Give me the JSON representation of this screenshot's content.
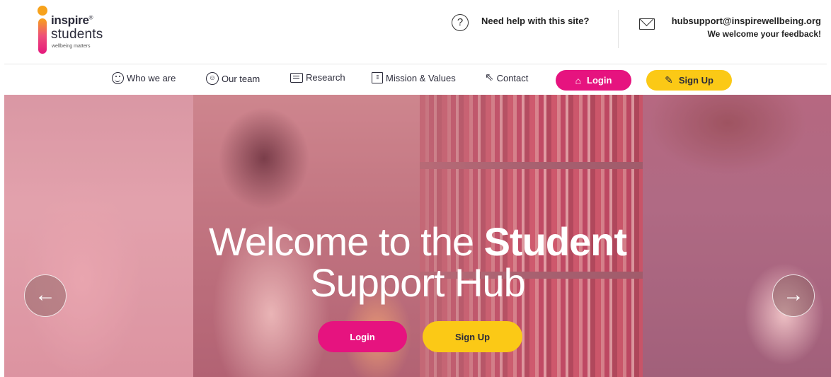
{
  "logo": {
    "brand_top": "inspire",
    "brand_mark": "®",
    "brand_bottom": "students",
    "tagline": "wellbeing matters"
  },
  "header": {
    "help_text": "Need help with this site?",
    "help_icon": "question-circle-icon",
    "email": "hubsupport@inspirewellbeing.org",
    "feedback": "We welcome your feedback!",
    "email_icon": "envelope-icon"
  },
  "nav": {
    "items": [
      {
        "label": "Who we are",
        "icon": "smiley-icon"
      },
      {
        "label": "Our team",
        "icon": "team-icon"
      },
      {
        "label": "Research",
        "icon": "document-icon"
      },
      {
        "label": "Mission & Values",
        "icon": "grid-icon"
      },
      {
        "label": "Contact",
        "icon": "cursor-click-icon"
      }
    ],
    "login_label": "Login",
    "signup_label": "Sign Up"
  },
  "hero": {
    "title_part1": "Welcome to the ",
    "title_bold": "Student",
    "title_line2": "Support Hub",
    "login_label": "Login",
    "signup_label": "Sign Up"
  },
  "colors": {
    "brand_pink": "#e6137f",
    "brand_yellow": "#fbc916",
    "text_dark": "#2b2b3a"
  }
}
